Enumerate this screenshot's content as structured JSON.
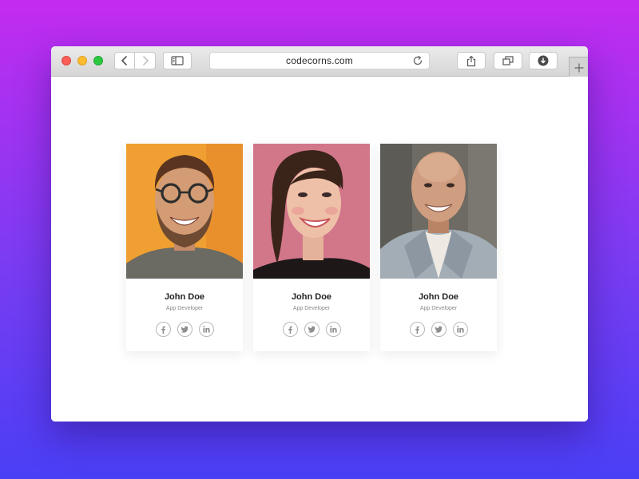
{
  "browser": {
    "url": "codecorns.com",
    "toolbar_icons": [
      "chevron-left-icon",
      "chevron-right-icon",
      "sidebar-icon",
      "reload-icon",
      "share-icon",
      "tabs-icon",
      "download-icon",
      "plus-icon"
    ]
  },
  "colors": {
    "background_top": "#c32bf0",
    "background_bottom": "#4a3ff5",
    "close": "#fc5f57",
    "minimize": "#fdbb2e",
    "zoom": "#2bc840"
  },
  "team": [
    {
      "name": "John Doe",
      "role": "App Developer",
      "photo": "man-with-glasses-orange-background",
      "socials": [
        "facebook-icon",
        "twitter-icon",
        "linkedin-icon"
      ]
    },
    {
      "name": "John Doe",
      "role": "App Developer",
      "photo": "woman-smiling-pink-background",
      "socials": [
        "facebook-icon",
        "twitter-icon",
        "linkedin-icon"
      ]
    },
    {
      "name": "John Doe",
      "role": "App Developer",
      "photo": "bald-man-grey-blazer-stone-background",
      "socials": [
        "facebook-icon",
        "twitter-icon",
        "linkedin-icon"
      ]
    }
  ]
}
